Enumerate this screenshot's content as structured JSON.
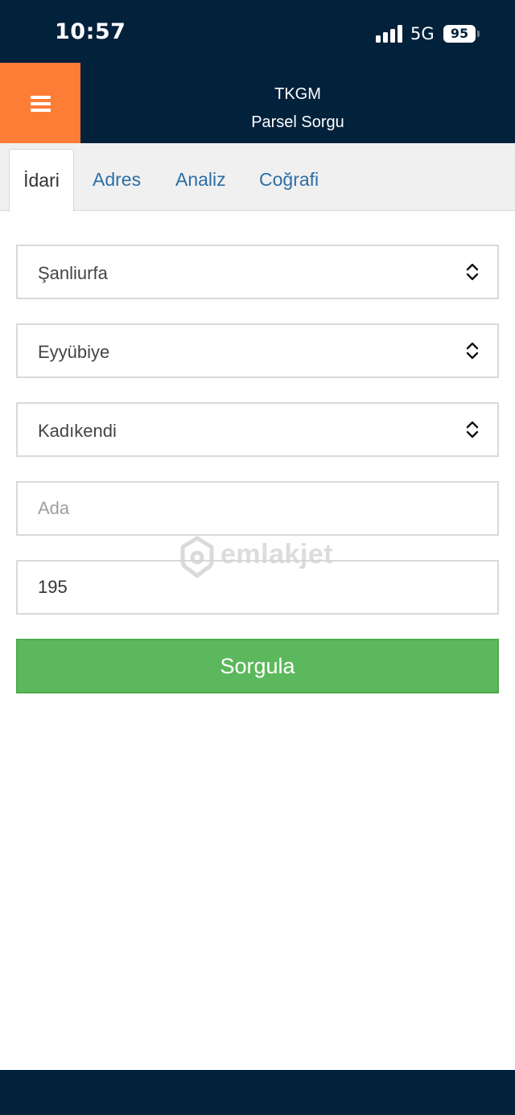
{
  "status_bar": {
    "time": "10:57",
    "network": "5G",
    "battery": "95"
  },
  "header": {
    "title": "TKGM",
    "subtitle": "Parsel Sorgu",
    "menu_icon": "hamburger-menu-icon"
  },
  "tabs": [
    {
      "label": "İdari",
      "active": true
    },
    {
      "label": "Adres",
      "active": false
    },
    {
      "label": "Analiz",
      "active": false
    },
    {
      "label": "Coğrafi",
      "active": false
    }
  ],
  "form": {
    "province": "Şanliurfa",
    "district": "Eyyübiye",
    "neighborhood": "Kadıkendi",
    "ada_placeholder": "Ada",
    "ada_value": "",
    "parsel_value": "195",
    "submit_label": "Sorgula"
  },
  "watermark": {
    "text": "emlakjet"
  },
  "colors": {
    "dark_navy": "#02213b",
    "menu_orange": "#fd7c36",
    "submit_green": "#5cb85c",
    "tab_blue": "#2c6ea5"
  }
}
